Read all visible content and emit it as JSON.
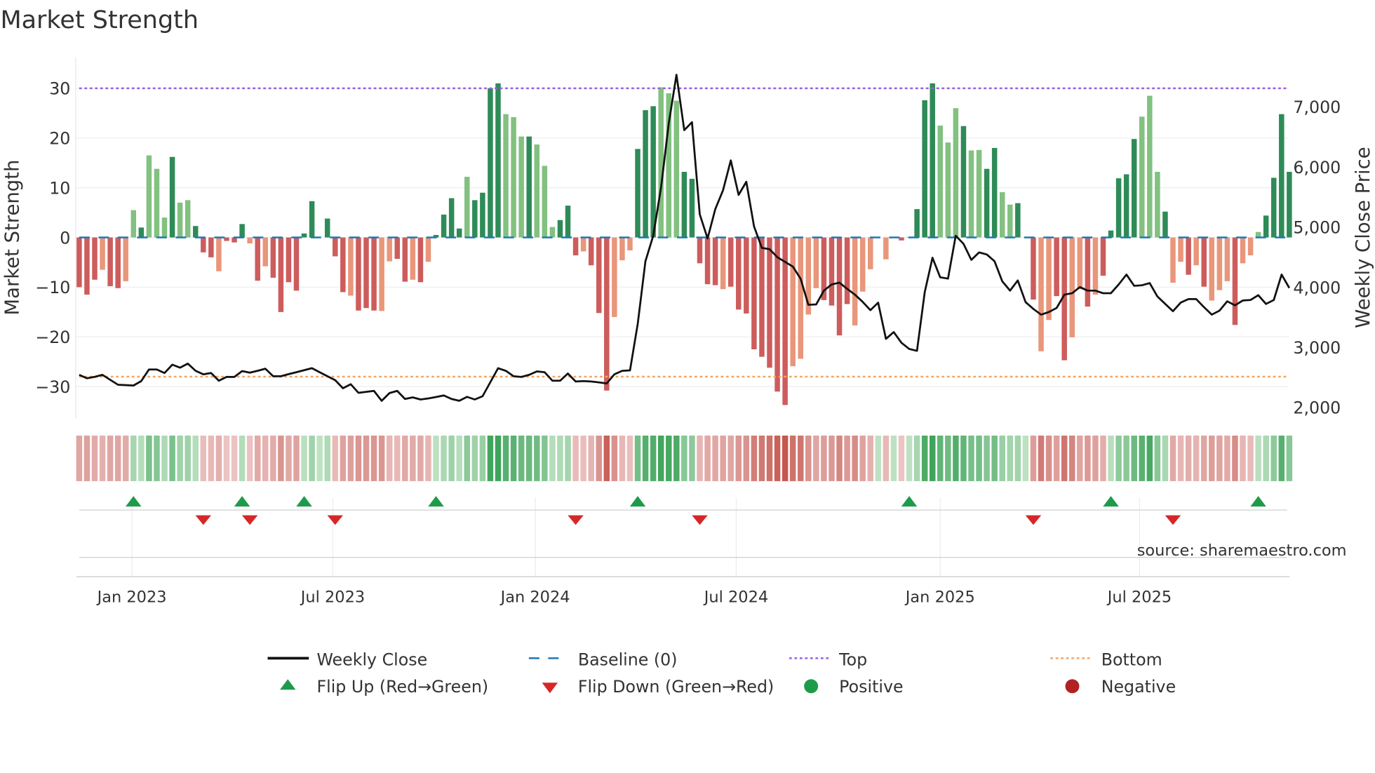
{
  "title": "Market Strength",
  "source": "source: sharemaestro.com",
  "colors": {
    "green_dark": "#2e8b57",
    "green_light": "#82c17f",
    "red_dark": "#cd5c5c",
    "red_light": "#e9967a",
    "top": "#9b5de5",
    "bottom": "#f4a460",
    "baseline": "#1f77b4",
    "price": "#111111",
    "flip_up": "#1e9b4a",
    "flip_down": "#d62728",
    "positive": "#1e9b4a",
    "negative": "#b22222"
  },
  "legend": {
    "weekly_close": "Weekly Close",
    "baseline": "Baseline (0)",
    "top": "Top",
    "bottom": "Bottom",
    "flip_up": "Flip Up (Red→Green)",
    "flip_down": "Flip Down (Green→Red)",
    "positive": "Positive",
    "negative": "Negative"
  },
  "chart_data": {
    "type": "bar",
    "title": "Market Strength",
    "ylabel": "Market Strength",
    "y2label": "Weekly Close Price",
    "ylim": [
      -36.5,
      36.3
    ],
    "y2lim": [
      1810,
      7830
    ],
    "yticks": [
      -30,
      -20,
      -10,
      0,
      10,
      20,
      30
    ],
    "ytick_labels": [
      "−30",
      "−20",
      "−10",
      "0",
      "10",
      "20",
      "30"
    ],
    "y2ticks": [
      2000,
      3000,
      4000,
      5000,
      6000,
      7000
    ],
    "y2tick_labels": [
      "2,000",
      "3,000",
      "4,000",
      "5,000",
      "6,000",
      "7,000"
    ],
    "top_level": 30,
    "bottom_level": -28,
    "baseline": 0,
    "xticks": [
      {
        "week": 6.8,
        "label": "Jan 2023"
      },
      {
        "week": 32.7,
        "label": "Jul 2023"
      },
      {
        "week": 58.8,
        "label": "Jan 2024"
      },
      {
        "week": 84.7,
        "label": "Jul 2024"
      },
      {
        "week": 111,
        "label": "Jan 2025"
      },
      {
        "week": 136.7,
        "label": "Jul 2025"
      }
    ],
    "strength": [
      -10,
      -11.5,
      -8.5,
      -6.5,
      -9.8,
      -10.2,
      -8.8,
      5.5,
      2,
      16.5,
      13.8,
      4,
      16.2,
      7,
      7.5,
      2.3,
      -3,
      -4,
      -6.8,
      -0.7,
      -1,
      2.7,
      -1.2,
      -8.7,
      -5.8,
      -8.1,
      -15,
      -9,
      -10.7,
      0.8,
      7.3,
      0,
      3.8,
      -3.8,
      -11,
      -11.7,
      -14.7,
      -14.2,
      -14.7,
      -14.8,
      -4.8,
      -4.3,
      -8.9,
      -8.5,
      -9,
      -4.9,
      0.5,
      4.6,
      7.9,
      1.8,
      12.2,
      7.5,
      9,
      30,
      31,
      24.8,
      24.2,
      20.3,
      20.3,
      18.7,
      14.4,
      2.1,
      3.5,
      6.4,
      -3.6,
      -2.8,
      -5.6,
      -15.2,
      -30.8,
      -16,
      -4.6,
      -2.6,
      17.8,
      25.6,
      26.4,
      30.2,
      29,
      27.5,
      13.2,
      11.8,
      -5.2,
      -9.4,
      -9.6,
      -10.4,
      -9.9,
      -14.5,
      -15.3,
      -22.5,
      -24,
      -26.2,
      -31,
      -33.7,
      -25.9,
      -24.4,
      -15.5,
      -10.2,
      -12.6,
      -13.7,
      -19.7,
      -13.4,
      -17.7,
      -10.9,
      -6.4,
      0,
      -4.4,
      0,
      -0.6,
      0.1,
      5.7,
      27.6,
      31,
      22.5,
      19.1,
      26,
      22.4,
      17.5,
      17.6,
      13.8,
      18,
      9.1,
      6.6,
      6.9,
      0,
      -12.5,
      -22.9,
      -16.6,
      -11.8,
      -24.7,
      -20.1,
      -10.4,
      -13.9,
      -11.5,
      -7.7,
      1.4,
      11.9,
      12.7,
      19.8,
      24.3,
      28.5,
      13.2,
      5.2,
      -9.1,
      -4.9,
      -7.5,
      -5.6,
      -9.9,
      -12.7,
      -10.6,
      -8.8,
      -17.6,
      -5.2,
      -3.6,
      1.1,
      4.4,
      12,
      24.8,
      13.2
    ],
    "shade": "dddlddlldllldlldddldddldlddddddddddldddllddldlddddlddddllldllldddldddllldddllldddddlddddddddllllddddllldlddldddllldllddlldddllddlldldddddllldlldldllldllldddddl",
    "weekly_close": [
      2543,
      2486,
      2510,
      2543,
      2460,
      2378,
      2372,
      2365,
      2440,
      2632,
      2632,
      2574,
      2712,
      2663,
      2730,
      2610,
      2552,
      2574,
      2445,
      2508,
      2508,
      2606,
      2580,
      2610,
      2645,
      2520,
      2520,
      2555,
      2587,
      2620,
      2654,
      2587,
      2520,
      2454,
      2320,
      2387,
      2245,
      2260,
      2276,
      2111,
      2240,
      2276,
      2142,
      2169,
      2134,
      2151,
      2175,
      2200,
      2142,
      2111,
      2178,
      2134,
      2187,
      2420,
      2654,
      2610,
      2520,
      2508,
      2543,
      2600,
      2587,
      2445,
      2445,
      2565,
      2432,
      2440,
      2432,
      2418,
      2400,
      2552,
      2610,
      2618,
      3388,
      4433,
      4856,
      5657,
      6724,
      7534,
      6613,
      6746,
      5212,
      4811,
      5300,
      5612,
      6110,
      5536,
      5754,
      5012,
      4656,
      4634,
      4500,
      4420,
      4344,
      4144,
      3708,
      3713,
      3944,
      4046,
      4077,
      3975,
      3877,
      3757,
      3619,
      3744,
      3143,
      3254,
      3077,
      2974,
      2943,
      3922,
      4491,
      4166,
      4144,
      4856,
      4722,
      4456,
      4580,
      4544,
      4433,
      4100,
      3944,
      4113,
      3753,
      3641,
      3544,
      3588,
      3655,
      3877,
      3900,
      4002,
      3944,
      3944,
      3900,
      3900,
      4046,
      4211,
      4024,
      4033,
      4069,
      3846,
      3722,
      3601,
      3744,
      3802,
      3802,
      3668,
      3544,
      3611,
      3766,
      3699,
      3779,
      3788,
      3868,
      3722,
      3788,
      4211,
      3988
    ],
    "flip_up_weeks": [
      7,
      21,
      29,
      46,
      72,
      107,
      133,
      152
    ],
    "flip_down_weeks": [
      16,
      22,
      33,
      64,
      80,
      123,
      141
    ]
  }
}
